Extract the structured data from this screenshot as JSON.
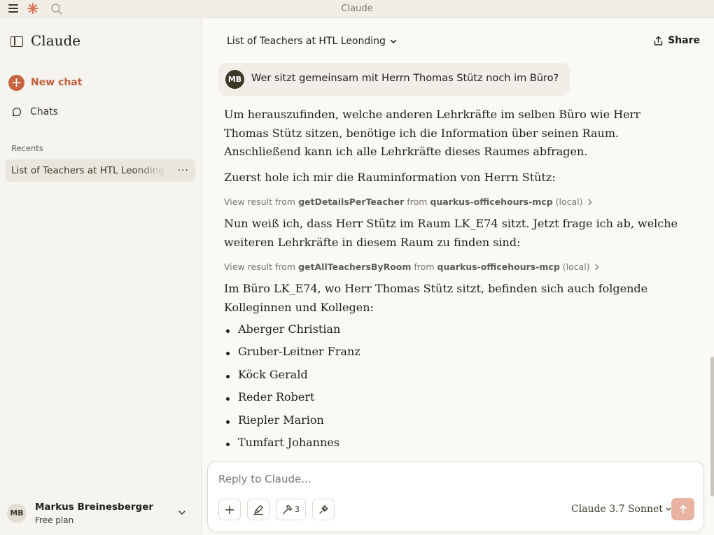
{
  "window": {
    "title": "Claude"
  },
  "sidebar": {
    "brand": "Claude",
    "new_chat": "New chat",
    "chats": "Chats",
    "recents_title": "Recents",
    "recents": [
      {
        "label": "List of Teachers at HTL Leonding"
      }
    ],
    "user": {
      "initials": "MB",
      "name": "Markus Breinesberger",
      "plan": "Free plan"
    }
  },
  "header": {
    "chat_title": "List of Teachers at HTL Leonding",
    "share": "Share"
  },
  "conversation": {
    "user_message": {
      "initials": "MB",
      "text": "Wer sitzt gemeinsam mit Herrn Thomas Stütz noch im Büro?"
    },
    "paragraph_1": "Um herauszufinden, welche anderen Lehrkräfte im selben Büro wie Herr Thomas Stütz sitzen, benötige ich die Information über seinen Raum. Anschließend kann ich alle Lehrkräfte dieses Raumes abfragen.",
    "paragraph_2": "Zuerst hole ich mir die Rauminformation von Herrn Stütz:",
    "tool_1": {
      "prefix": "View result from",
      "tool": "getDetailsPerTeacher",
      "from": "from",
      "server": "quarkus-officehours-mcp",
      "suffix": "(local)"
    },
    "paragraph_3": "Nun weiß ich, dass Herr Stütz im Raum LK_E74 sitzt. Jetzt frage ich ab, welche weiteren Lehrkräfte in diesem Raum zu finden sind:",
    "tool_2": {
      "prefix": "View result from",
      "tool": "getAllTeachersByRoom",
      "from": "from",
      "server": "quarkus-officehours-mcp",
      "suffix": "(local)"
    },
    "paragraph_4": "Im Büro LK_E74, wo Herr Thomas Stütz sitzt, befinden sich auch folgende Kolleginnen und Kollegen:",
    "teachers": [
      "Aberger Christian",
      "Gruber-Leitner Franz",
      "Köck Gerald",
      "Reder Robert",
      "Riepler Marion",
      "Tumfart Johannes"
    ]
  },
  "composer": {
    "placeholder": "Reply to Claude...",
    "tools_count": "3",
    "model": "Claude 3.7 Sonnet"
  },
  "colors": {
    "accent": "#c96442",
    "send_disabled": "#e8b3a0",
    "background": "#faf9f5",
    "sidebar": "#f5f4ef"
  }
}
